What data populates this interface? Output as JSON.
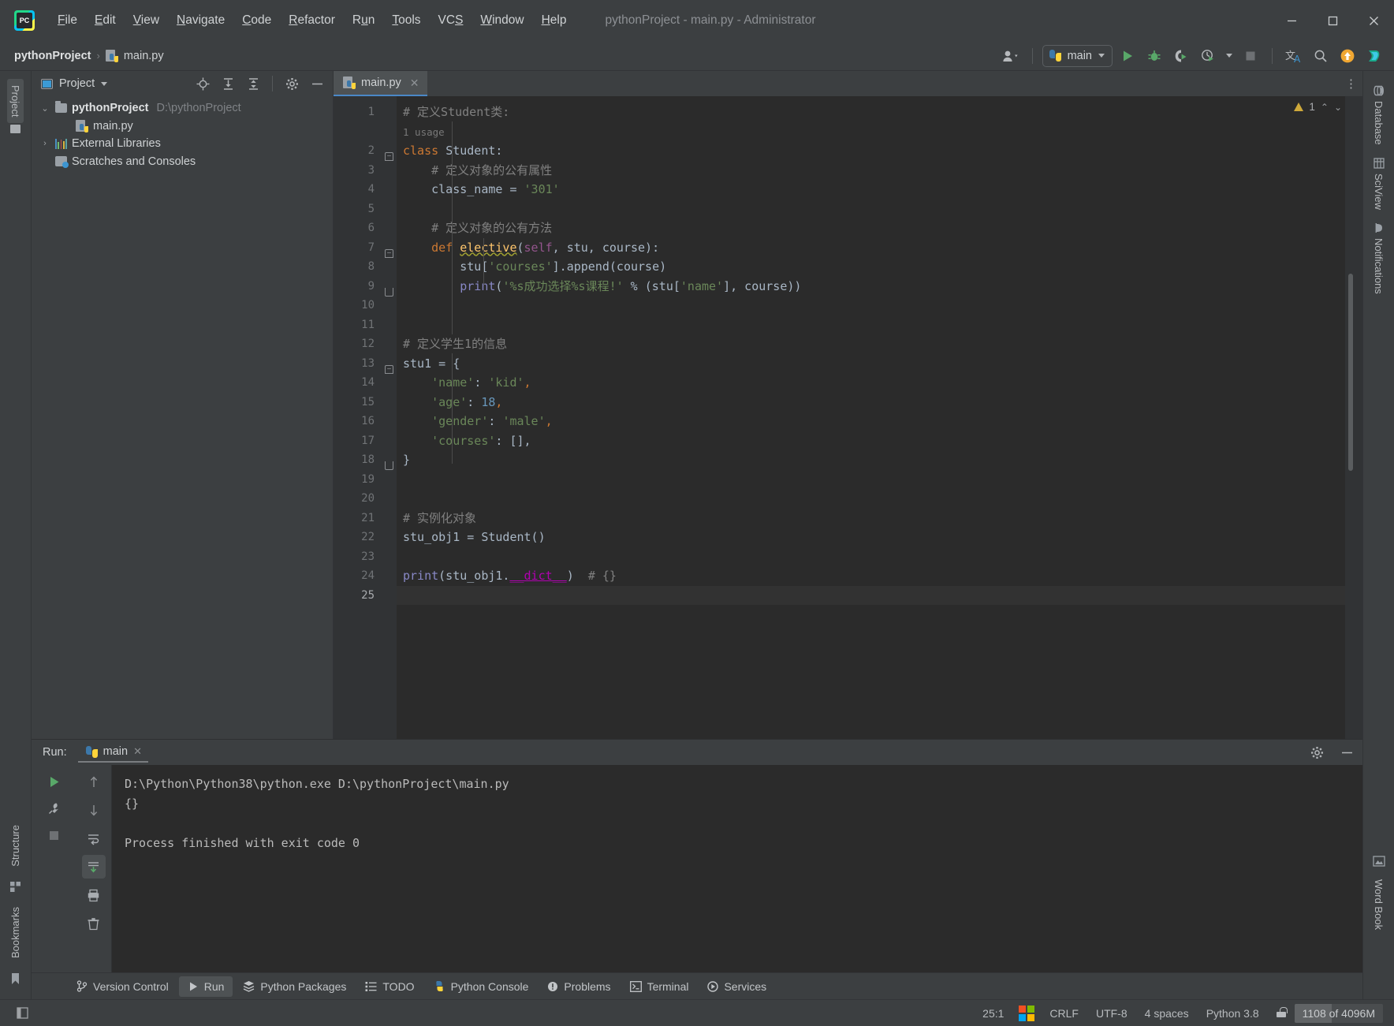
{
  "window": {
    "title": "pythonProject - main.py - Administrator",
    "logo_text": "PC",
    "minimize": "—",
    "maximize": "▢",
    "close": "✕"
  },
  "menu": [
    {
      "label": "File",
      "mnemonic": "F"
    },
    {
      "label": "Edit",
      "mnemonic": "E"
    },
    {
      "label": "View",
      "mnemonic": "V"
    },
    {
      "label": "Navigate",
      "mnemonic": "N"
    },
    {
      "label": "Code",
      "mnemonic": "C"
    },
    {
      "label": "Refactor",
      "mnemonic": "R"
    },
    {
      "label": "Run",
      "mnemonic": "u"
    },
    {
      "label": "Tools",
      "mnemonic": "T"
    },
    {
      "label": "VCS",
      "mnemonic": "S"
    },
    {
      "label": "Window",
      "mnemonic": "W"
    },
    {
      "label": "Help",
      "mnemonic": "H"
    }
  ],
  "breadcrumb": {
    "project": "pythonProject",
    "separator": "›",
    "file": "main.py"
  },
  "toolbar": {
    "run_config": "main",
    "icons": [
      {
        "name": "user-account-icon",
        "glyph": "👤"
      },
      {
        "name": "run-icon",
        "glyph": "▶"
      },
      {
        "name": "debug-icon",
        "glyph": "🐞"
      },
      {
        "name": "run-with-coverage-icon",
        "glyph": "◖"
      },
      {
        "name": "profile-icon",
        "glyph": "◴"
      },
      {
        "name": "stop-icon",
        "glyph": "■"
      },
      {
        "name": "translate-icon",
        "glyph": "文A"
      },
      {
        "name": "search-everywhere-icon",
        "glyph": "🔍"
      },
      {
        "name": "update-icon",
        "glyph": "↑"
      },
      {
        "name": "ide-feature-icon",
        "glyph": "▶"
      }
    ]
  },
  "left_stripe": {
    "project_tab": "Project",
    "bookmarks_tab": "Bookmarks",
    "structure_tab": "Structure"
  },
  "right_stripe": {
    "database_tab": "Database",
    "sciview_tab": "SciView",
    "notifications_tab": "Notifications",
    "wordbook_tab": "Word Book"
  },
  "project_panel": {
    "title": "Project",
    "header_buttons": [
      {
        "name": "select-opened-file-icon"
      },
      {
        "name": "expand-all-icon"
      },
      {
        "name": "collapse-all-icon"
      },
      {
        "name": "settings-gear-icon"
      },
      {
        "name": "hide-panel-icon"
      }
    ],
    "tree": [
      {
        "label": "pythonProject",
        "path": "D:\\pythonProject",
        "icon": "folder-icon",
        "arrow": "⌄",
        "depth": 0,
        "bold": true
      },
      {
        "label": "main.py",
        "path": "",
        "icon": "python-file-icon",
        "arrow": "",
        "depth": 1,
        "bold": false
      },
      {
        "label": "External Libraries",
        "path": "",
        "icon": "library-icon",
        "arrow": "›",
        "depth": 0,
        "bold": false
      },
      {
        "label": "Scratches and Consoles",
        "path": "",
        "icon": "scratch-icon",
        "arrow": "",
        "depth": 0,
        "bold": false
      }
    ]
  },
  "editor": {
    "tab_label": "main.py",
    "tab_close": "✕",
    "kebab": "⋮",
    "inspection_count": "1",
    "usage_hint": "1 usage",
    "lines": [
      {
        "n": "1",
        "segments": [
          {
            "t": "# 定义Student类:",
            "c": "c-com"
          }
        ],
        "indent": 0
      },
      {
        "n": "2",
        "segments": [
          {
            "t": "class ",
            "c": "c-kw"
          },
          {
            "t": "Student",
            "c": "c-cls"
          },
          {
            "t": ":",
            "c": "c-op"
          }
        ],
        "indent": 0
      },
      {
        "n": "3",
        "segments": [
          {
            "t": "    # 定义对象的公有属性",
            "c": "c-com"
          }
        ],
        "indent": 1
      },
      {
        "n": "4",
        "segments": [
          {
            "t": "    class_name = ",
            "c": "c-dflt"
          },
          {
            "t": "'301'",
            "c": "c-str"
          }
        ],
        "indent": 1
      },
      {
        "n": "5",
        "segments": [],
        "indent": 1
      },
      {
        "n": "6",
        "segments": [
          {
            "t": "    # 定义对象的公有方法",
            "c": "c-com"
          }
        ],
        "indent": 1
      },
      {
        "n": "7",
        "segments": [
          {
            "t": "    ",
            "c": "c-dflt"
          },
          {
            "t": "def ",
            "c": "c-kw"
          },
          {
            "t": "elective",
            "c": "c-fn"
          },
          {
            "t": "(",
            "c": "c-op"
          },
          {
            "t": "self",
            "c": "c-self"
          },
          {
            "t": ", stu, course):",
            "c": "c-dflt"
          }
        ],
        "indent": 1
      },
      {
        "n": "8",
        "segments": [
          {
            "t": "        stu[",
            "c": "c-dflt"
          },
          {
            "t": "'courses'",
            "c": "c-str"
          },
          {
            "t": "].append(course)",
            "c": "c-dflt"
          }
        ],
        "indent": 2
      },
      {
        "n": "9",
        "segments": [
          {
            "t": "        ",
            "c": "c-dflt"
          },
          {
            "t": "print",
            "c": "c-func"
          },
          {
            "t": "(",
            "c": "c-op"
          },
          {
            "t": "'%s成功选择%s课程!'",
            "c": "c-str"
          },
          {
            "t": " % (stu[",
            "c": "c-dflt"
          },
          {
            "t": "'name'",
            "c": "c-str"
          },
          {
            "t": "], course))",
            "c": "c-dflt"
          }
        ],
        "indent": 2
      },
      {
        "n": "10",
        "segments": [],
        "indent": 0
      },
      {
        "n": "11",
        "segments": [],
        "indent": 0
      },
      {
        "n": "12",
        "segments": [
          {
            "t": "# 定义学生1的信息",
            "c": "c-com"
          }
        ],
        "indent": 0
      },
      {
        "n": "13",
        "segments": [
          {
            "t": "stu1 = {",
            "c": "c-dflt"
          }
        ],
        "indent": 0
      },
      {
        "n": "14",
        "segments": [
          {
            "t": "    ",
            "c": "c-dflt"
          },
          {
            "t": "'name'",
            "c": "c-str"
          },
          {
            "t": ": ",
            "c": "c-dflt"
          },
          {
            "t": "'kid'",
            "c": "c-str"
          },
          {
            "t": ",",
            "c": "c-kw"
          }
        ],
        "indent": 1
      },
      {
        "n": "15",
        "segments": [
          {
            "t": "    ",
            "c": "c-dflt"
          },
          {
            "t": "'age'",
            "c": "c-str"
          },
          {
            "t": ": ",
            "c": "c-dflt"
          },
          {
            "t": "18",
            "c": "c-num"
          },
          {
            "t": ",",
            "c": "c-kw"
          }
        ],
        "indent": 1
      },
      {
        "n": "16",
        "segments": [
          {
            "t": "    ",
            "c": "c-dflt"
          },
          {
            "t": "'gender'",
            "c": "c-str"
          },
          {
            "t": ": ",
            "c": "c-dflt"
          },
          {
            "t": "'male'",
            "c": "c-str"
          },
          {
            "t": ",",
            "c": "c-kw"
          }
        ],
        "indent": 1
      },
      {
        "n": "17",
        "segments": [
          {
            "t": "    ",
            "c": "c-dflt"
          },
          {
            "t": "'courses'",
            "c": "c-str"
          },
          {
            "t": ": [],",
            "c": "c-dflt"
          }
        ],
        "indent": 1
      },
      {
        "n": "18",
        "segments": [
          {
            "t": "}",
            "c": "c-dflt"
          }
        ],
        "indent": 0
      },
      {
        "n": "19",
        "segments": [],
        "indent": 0
      },
      {
        "n": "20",
        "segments": [],
        "indent": 0
      },
      {
        "n": "21",
        "segments": [
          {
            "t": "# 实例化对象",
            "c": "c-com"
          }
        ],
        "indent": 0
      },
      {
        "n": "22",
        "segments": [
          {
            "t": "stu_obj1 = Student()",
            "c": "c-dflt"
          }
        ],
        "indent": 0
      },
      {
        "n": "23",
        "segments": [],
        "indent": 0
      },
      {
        "n": "24",
        "segments": [
          {
            "t": "print",
            "c": "c-func"
          },
          {
            "t": "(stu_obj1.",
            "c": "c-dflt"
          },
          {
            "t": "__dict__",
            "c": "c-dund"
          },
          {
            "t": ")  ",
            "c": "c-dflt"
          },
          {
            "t": "# {}",
            "c": "c-com"
          }
        ],
        "indent": 0
      },
      {
        "n": "25",
        "segments": [],
        "indent": 0,
        "current": true
      }
    ]
  },
  "run_panel": {
    "label": "Run:",
    "tab": "main",
    "tab_close": "✕",
    "settings_icon": "gear-icon",
    "hide_icon": "minimize-icon",
    "side_buttons": [
      {
        "name": "rerun-icon"
      },
      {
        "name": "modify-run-config-icon"
      },
      {
        "name": "stop-icon"
      },
      {
        "name": "up-stack-icon"
      },
      {
        "name": "down-stack-icon"
      },
      {
        "name": "soft-wrap-icon"
      },
      {
        "name": "scroll-to-end-icon"
      },
      {
        "name": "print-icon"
      },
      {
        "name": "clear-all-icon"
      }
    ],
    "console_lines": [
      "D:\\Python\\Python38\\python.exe D:\\pythonProject\\main.py",
      "{}",
      "",
      "Process finished with exit code 0"
    ]
  },
  "bottom_bar": [
    {
      "label": "Version Control",
      "icon": "branch-icon",
      "active": false
    },
    {
      "label": "Run",
      "icon": "run-icon",
      "active": true
    },
    {
      "label": "Python Packages",
      "icon": "packages-icon",
      "active": false
    },
    {
      "label": "TODO",
      "icon": "todo-list-icon",
      "active": false
    },
    {
      "label": "Python Console",
      "icon": "python-console-icon",
      "active": false
    },
    {
      "label": "Problems",
      "icon": "problems-icon",
      "active": false
    },
    {
      "label": "Terminal",
      "icon": "terminal-icon",
      "active": false
    },
    {
      "label": "Services",
      "icon": "services-icon",
      "active": false
    }
  ],
  "status_bar": {
    "caret": "25:1",
    "os_logo": "windows-logo-icon",
    "line_separator": "CRLF",
    "encoding": "UTF-8",
    "indent": "4 spaces",
    "interpreter": "Python 3.8",
    "lock": "read-write-lock-icon",
    "memory": "1108 of 4096M"
  },
  "colors": {
    "chrome_bg": "#3c3f41",
    "editor_bg": "#2b2b2b",
    "gutter_bg": "#313335",
    "accent_blue": "#4a88c7",
    "run_green": "#59a869",
    "warn_yellow": "#cfa93a",
    "string_green": "#6a8759",
    "keyword_orange": "#cc7832",
    "number_blue": "#6897bb",
    "comment_gray": "#808080"
  }
}
